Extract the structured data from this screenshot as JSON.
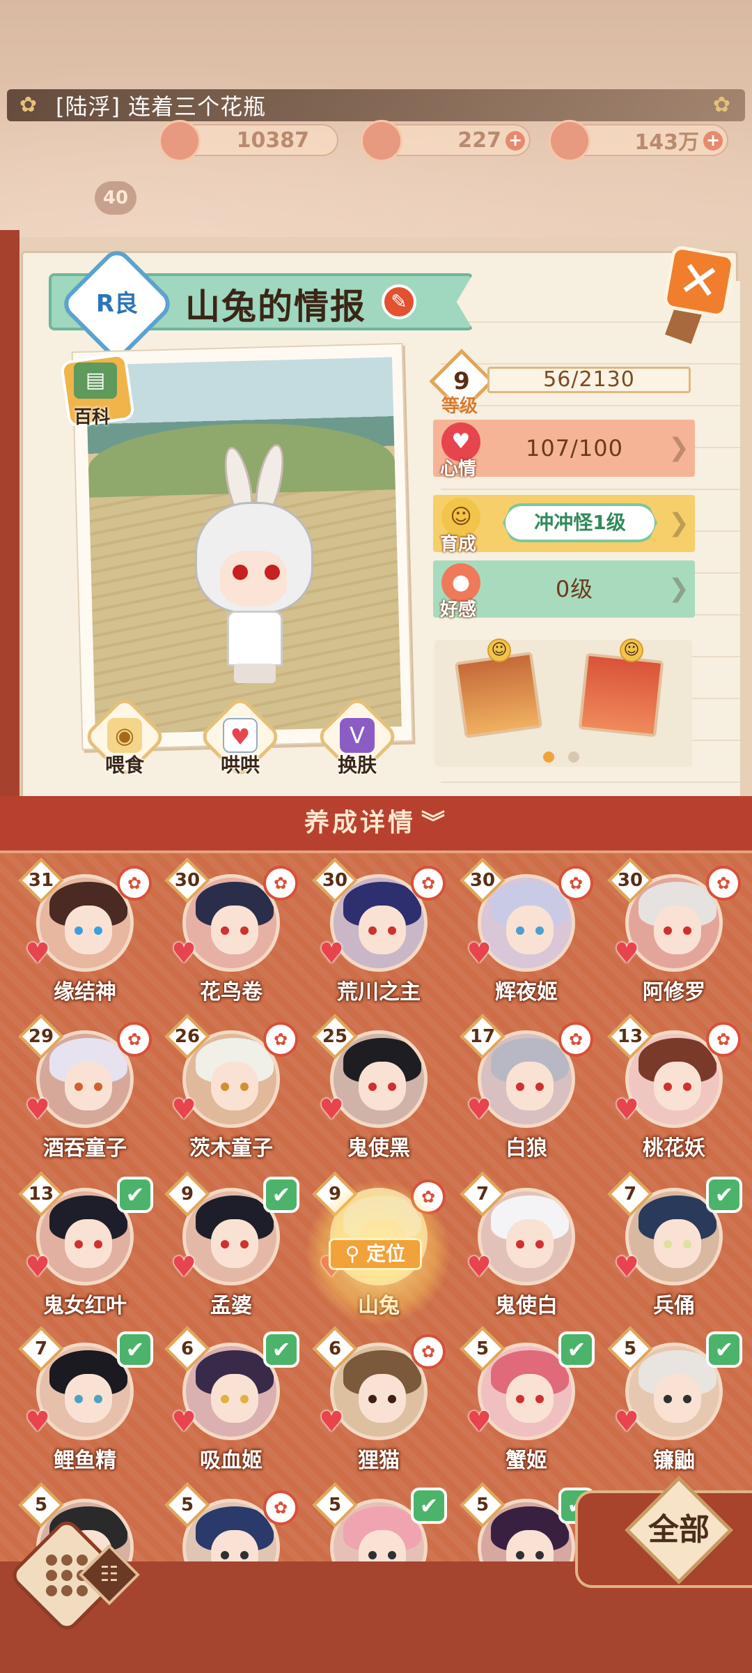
{
  "news": {
    "text": "[陆浮] 连着三个花瓶"
  },
  "currencies": [
    {
      "name": "coin",
      "value": "10387",
      "color": "#e79a7f"
    },
    {
      "name": "gem",
      "value": "227",
      "color": "#e7896f"
    },
    {
      "name": "gold",
      "value": "143万",
      "color": "#e89c6c"
    }
  ],
  "player": {
    "level": "40"
  },
  "panel": {
    "rarity": "R良",
    "title": "山兔的情报",
    "baike": "百科",
    "actions": {
      "feed": "喂食",
      "coax": "哄哄",
      "skin": "换肤"
    }
  },
  "stats": {
    "level_value": "9",
    "level_label": "等级",
    "exp": "56/2130",
    "mood_label": "心情",
    "mood_value": "107/100",
    "growth_label": "育成",
    "growth_value": "冲冲怪1级",
    "favor_label": "好感",
    "favor_value": "0级"
  },
  "details": {
    "label": "养成详情"
  },
  "locate": {
    "label": "定位"
  },
  "shikigami": [
    {
      "name": "缘结神",
      "level": "31",
      "badge": "✿",
      "hair": "#4a2a22",
      "bg": "#e7b7a0",
      "eye": "#3aa0e0"
    },
    {
      "name": "花鸟卷",
      "level": "30",
      "badge": "✿",
      "hair": "#2a2e4a",
      "bg": "#e7b0a4",
      "eye": "#d03030"
    },
    {
      "name": "荒川之主",
      "level": "30",
      "badge": "✿",
      "hair": "#2e2f6e",
      "bg": "#c9b6c6",
      "eye": "#d03030"
    },
    {
      "name": "辉夜姬",
      "level": "30",
      "badge": "✿",
      "hair": "#c9cbe6",
      "bg": "#d9c6d6",
      "eye": "#4aa0d0"
    },
    {
      "name": "阿修罗",
      "level": "30",
      "badge": "✿",
      "hair": "#e6e2e0",
      "bg": "#e3a59a",
      "eye": "#d03030"
    },
    {
      "name": "酒吞童子",
      "level": "29",
      "badge": "✿",
      "hair": "#e6e2f0",
      "bg": "#d6a89a",
      "eye": "#d06030"
    },
    {
      "name": "茨木童子",
      "level": "26",
      "badge": "✿",
      "hair": "#f0efe8",
      "bg": "#e0b89a",
      "eye": "#d09030"
    },
    {
      "name": "鬼使黑",
      "level": "25",
      "badge": "",
      "hair": "#1e1e22",
      "bg": "#cfb3a8",
      "eye": "#d03030"
    },
    {
      "name": "白狼",
      "level": "17",
      "badge": "✿",
      "hair": "#b8b8c4",
      "bg": "#d8c0c0",
      "eye": "#d03030"
    },
    {
      "name": "桃花妖",
      "level": "13",
      "badge": "✿",
      "hair": "#7a3a2a",
      "bg": "#f0c6c0",
      "eye": "#d03030"
    },
    {
      "name": "鬼女红叶",
      "level": "13",
      "badge": "✔",
      "hair": "#1e1e2a",
      "bg": "#e2b0a0",
      "eye": "#d03030"
    },
    {
      "name": "孟婆",
      "level": "9",
      "badge": "✔",
      "hair": "#1e1e2a",
      "bg": "#e3b8a6",
      "eye": "#d03030"
    },
    {
      "name": "山兔",
      "level": "9",
      "badge": "✿",
      "hair": "#efefef",
      "bg": "#f6e0b0",
      "eye": "#d03030"
    },
    {
      "name": "鬼使白",
      "level": "7",
      "badge": "",
      "hair": "#f4f4f6",
      "bg": "#e2c2b8",
      "eye": "#d03030"
    },
    {
      "name": "兵俑",
      "level": "7",
      "badge": "✔",
      "hair": "#2a3a5a",
      "bg": "#d8b8a0",
      "eye": "#e0e0a0"
    },
    {
      "name": "鲤鱼精",
      "level": "7",
      "badge": "✔",
      "hair": "#1a1a20",
      "bg": "#e6c0aa",
      "eye": "#50a0c0"
    },
    {
      "name": "吸血姬",
      "level": "6",
      "badge": "✔",
      "hair": "#3a2a4a",
      "bg": "#dab0b0",
      "eye": "#e0b040"
    },
    {
      "name": "狸猫",
      "level": "6",
      "badge": "✿",
      "hair": "#7a5a3a",
      "bg": "#dcc0a0",
      "eye": "#402010"
    },
    {
      "name": "蟹姬",
      "level": "5",
      "badge": "✔",
      "hair": "#e06a7a",
      "bg": "#f0c0c0",
      "eye": "#d03030"
    },
    {
      "name": "镰鼬",
      "level": "5",
      "badge": "✔",
      "hair": "#e8e4e0",
      "bg": "#e6c8b0",
      "eye": "#303030"
    },
    {
      "name": "",
      "level": "5",
      "badge": "",
      "hair": "#2a2a2a",
      "bg": "#d6b0a0",
      "eye": "#303030"
    },
    {
      "name": "",
      "level": "5",
      "badge": "✿",
      "hair": "#2a3a6a",
      "bg": "#e0c4b4",
      "eye": "#303030"
    },
    {
      "name": "",
      "level": "5",
      "badge": "✔",
      "hair": "#f0a4b0",
      "bg": "#e6c0b6",
      "eye": "#303030"
    },
    {
      "name": "",
      "level": "5",
      "badge": "✔",
      "hair": "#3a2040",
      "bg": "#d6a8a0",
      "eye": "#303030"
    }
  ],
  "filter": {
    "label": "全部"
  },
  "colors": {
    "accent": "#b7412e",
    "grid_bg": "#ce6e48",
    "check": "#4bb46a"
  }
}
